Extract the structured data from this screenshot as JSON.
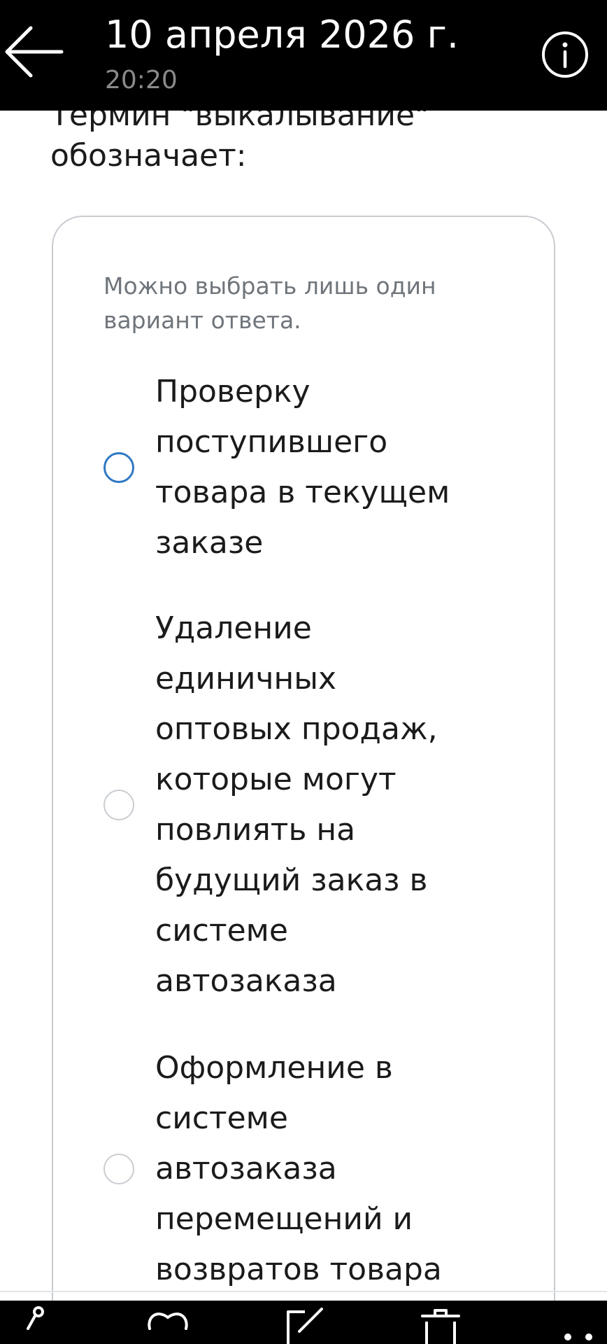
{
  "header": {
    "title": "10 апреля 2026 г.",
    "subtitle": "20:20"
  },
  "question": {
    "text": "Термин \"выкалывание\"\nобозначает:"
  },
  "answer_card": {
    "hint": "Можно выбрать лишь один\nвариант ответа.",
    "options": [
      {
        "label": "Проверку\nпоступившего\nтовара в текущем\nзаказе",
        "selected": false
      },
      {
        "label": "Удаление\nединичных\nоптовых продаж,\nкоторые могут\nповлиять на\nбудущий заказ в\nсистеме\nавтозаказа",
        "selected": false
      },
      {
        "label": "Оформление в\nсистеме\nавтозаказа\nперемещений и\nвозвратов товара",
        "selected": false
      }
    ]
  },
  "toolbar": {
    "icons": [
      "share-icon",
      "heart-icon",
      "edit-icon",
      "delete-icon",
      "more-icon"
    ]
  },
  "colors": {
    "topbar_bg": "#000000",
    "text": "#1b1b1b",
    "hint_text": "#6f757b",
    "radio_focus": "#2f78c4",
    "radio_border": "#c9cdd1",
    "card_border": "#c8cbd0"
  }
}
